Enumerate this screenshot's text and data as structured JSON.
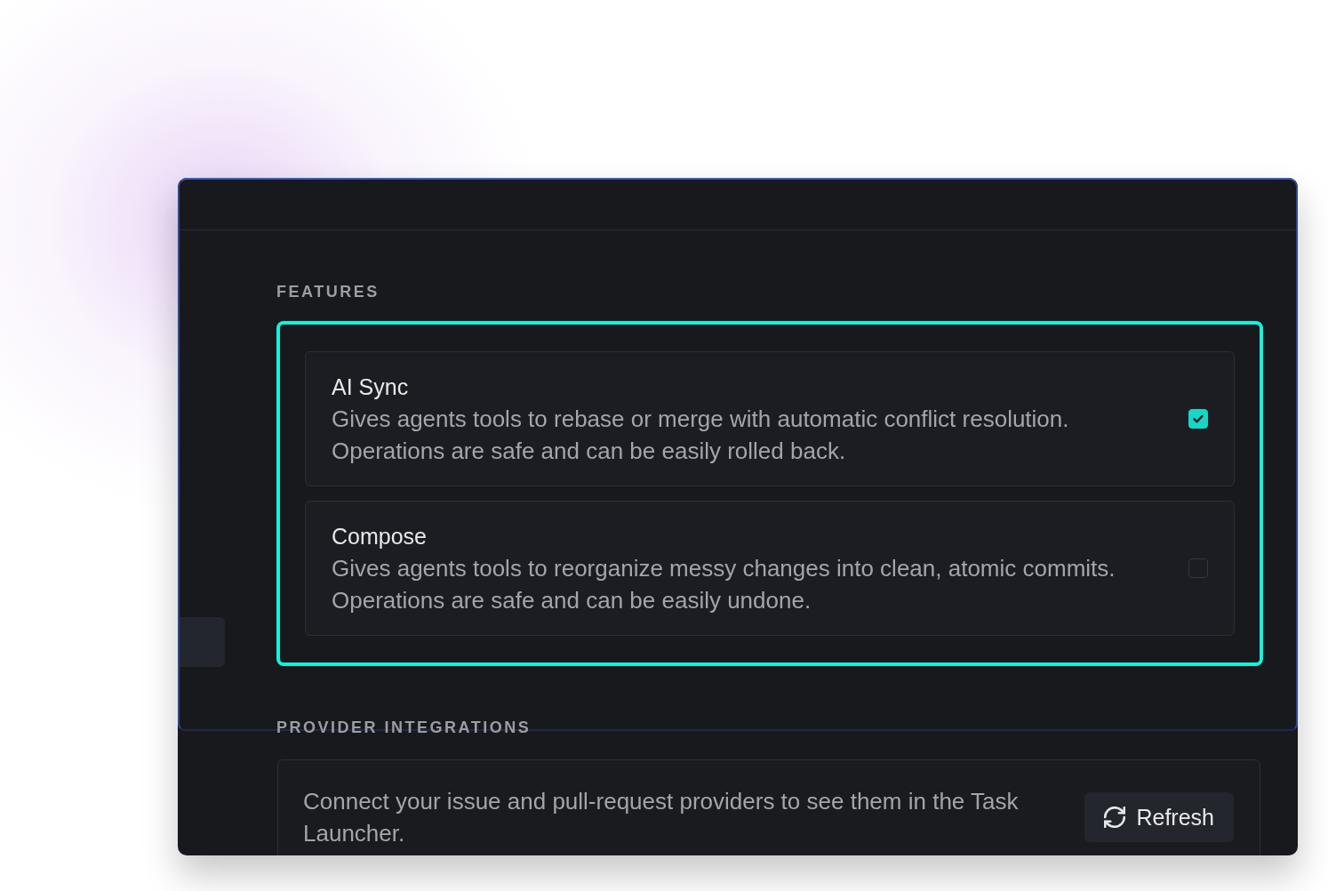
{
  "features": {
    "heading": "FEATURES",
    "highlighted": true,
    "items": [
      {
        "title": "AI Sync",
        "description": "Gives agents tools to rebase or merge with automatic conflict resolution.\nOperations are safe and can be easily rolled back.",
        "checked": true
      },
      {
        "title": "Compose",
        "description": "Gives agents tools to reorganize messy changes into clean, atomic commits.\nOperations are safe and can be easily undone.",
        "checked": false
      }
    ]
  },
  "provider_integrations": {
    "heading": "PROVIDER INTEGRATIONS",
    "description": "Connect your issue and pull-request providers to see them in the Task Launcher.",
    "refresh_button": {
      "label": "Refresh"
    }
  }
}
